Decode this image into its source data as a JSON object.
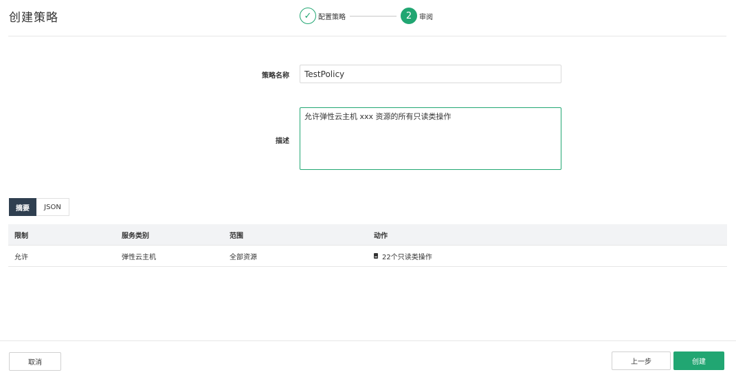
{
  "header": {
    "title": "创建策略",
    "steps": [
      {
        "marker": "✓",
        "label": "配置策略",
        "state": "done"
      },
      {
        "marker": "2",
        "label": "审阅",
        "state": "active"
      }
    ]
  },
  "form": {
    "name_label": "策略名称",
    "name_value": "TestPolicy",
    "desc_label": "描述",
    "desc_value": "允许弹性云主机 xxx 资源的所有只读类操作"
  },
  "tabs": [
    {
      "label": "摘要",
      "active": true
    },
    {
      "label": "JSON",
      "active": false
    }
  ],
  "table": {
    "columns": [
      "限制",
      "服务类别",
      "范围",
      "动作"
    ],
    "rows": [
      {
        "effect": "允许",
        "service": "弹性云主机",
        "scope": "全部资源",
        "action_icon": "document-icon",
        "action": "22个只读类操作"
      }
    ]
  },
  "footer": {
    "cancel_label": "取消",
    "prev_label": "上一步",
    "create_label": "创建"
  },
  "colors": {
    "accent": "#21a672",
    "tab_active": "#2f3f50"
  }
}
